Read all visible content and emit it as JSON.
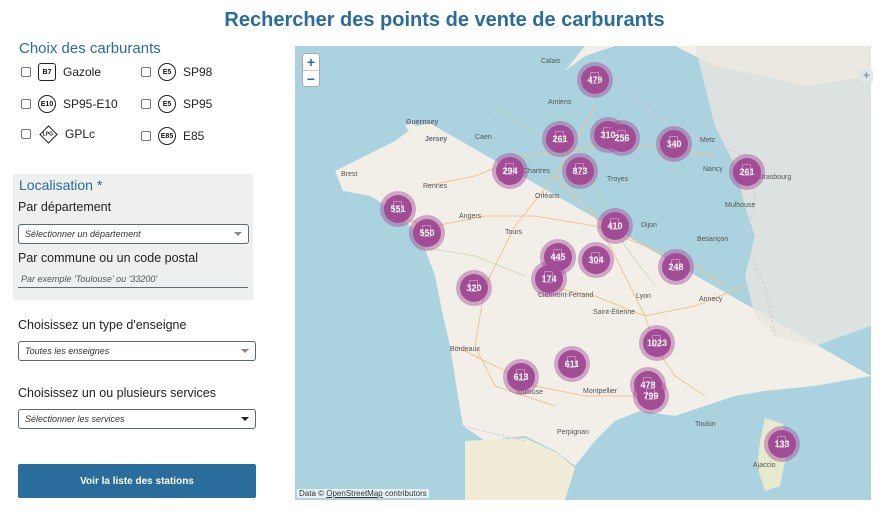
{
  "page_title": "Rechercher des points de vente de carburants",
  "fuels": {
    "title": "Choix des carburants",
    "options": [
      {
        "badge": "B7",
        "label": "Gazole"
      },
      {
        "badge": "E5",
        "label": "SP98"
      },
      {
        "badge": "E10",
        "label": "SP95-E10"
      },
      {
        "badge": "E5",
        "label": "SP95"
      },
      {
        "badge": "LPG",
        "label": "GPLc"
      },
      {
        "badge": "E85",
        "label": "E85"
      }
    ]
  },
  "localisation": {
    "title": "Localisation *",
    "by_department_label": "Par département",
    "department_placeholder": "Sélectionner un département",
    "by_city_label": "Par commune ou un code postal",
    "city_placeholder": "Par exemple 'Toulouse' ou '33200'"
  },
  "brand": {
    "label": "Choisissez un type d'enseigne",
    "value": "Toutes les enseignes"
  },
  "services": {
    "label": "Choisissez un ou plusieurs services",
    "placeholder": "Sélectionner les services"
  },
  "submit_label": "Voir la liste des stations",
  "map": {
    "zoom_in": "+",
    "zoom_out": "−",
    "layers": "+",
    "attribution_prefix": "Data © ",
    "attribution_link": "OpenStreetMap",
    "attribution_suffix": " contributors",
    "clusters": [
      "479",
      "261",
      "310",
      "256",
      "340",
      "294",
      "873",
      "261",
      "551",
      "550",
      "410",
      "445",
      "304",
      "174",
      "248",
      "320",
      "1023",
      "611",
      "613",
      "478",
      "799",
      "133"
    ],
    "cities": [
      "Calais",
      "Amiens",
      "Caen",
      "Metz",
      "Nancy",
      "Strasbourg",
      "Brest",
      "Rennes",
      "Chartres",
      "Troyes",
      "Orléans",
      "Mulhouse",
      "Angers",
      "Tours",
      "Dijon",
      "Besançon",
      "Clermont-Ferrand",
      "Lyon",
      "Annecy",
      "Saint-Étienne",
      "Bordeaux",
      "Toulouse",
      "Montpellier",
      "Toulon",
      "Perpignan",
      "Ajaccio"
    ],
    "islands": [
      "Guernsey",
      "Jersey"
    ]
  }
}
